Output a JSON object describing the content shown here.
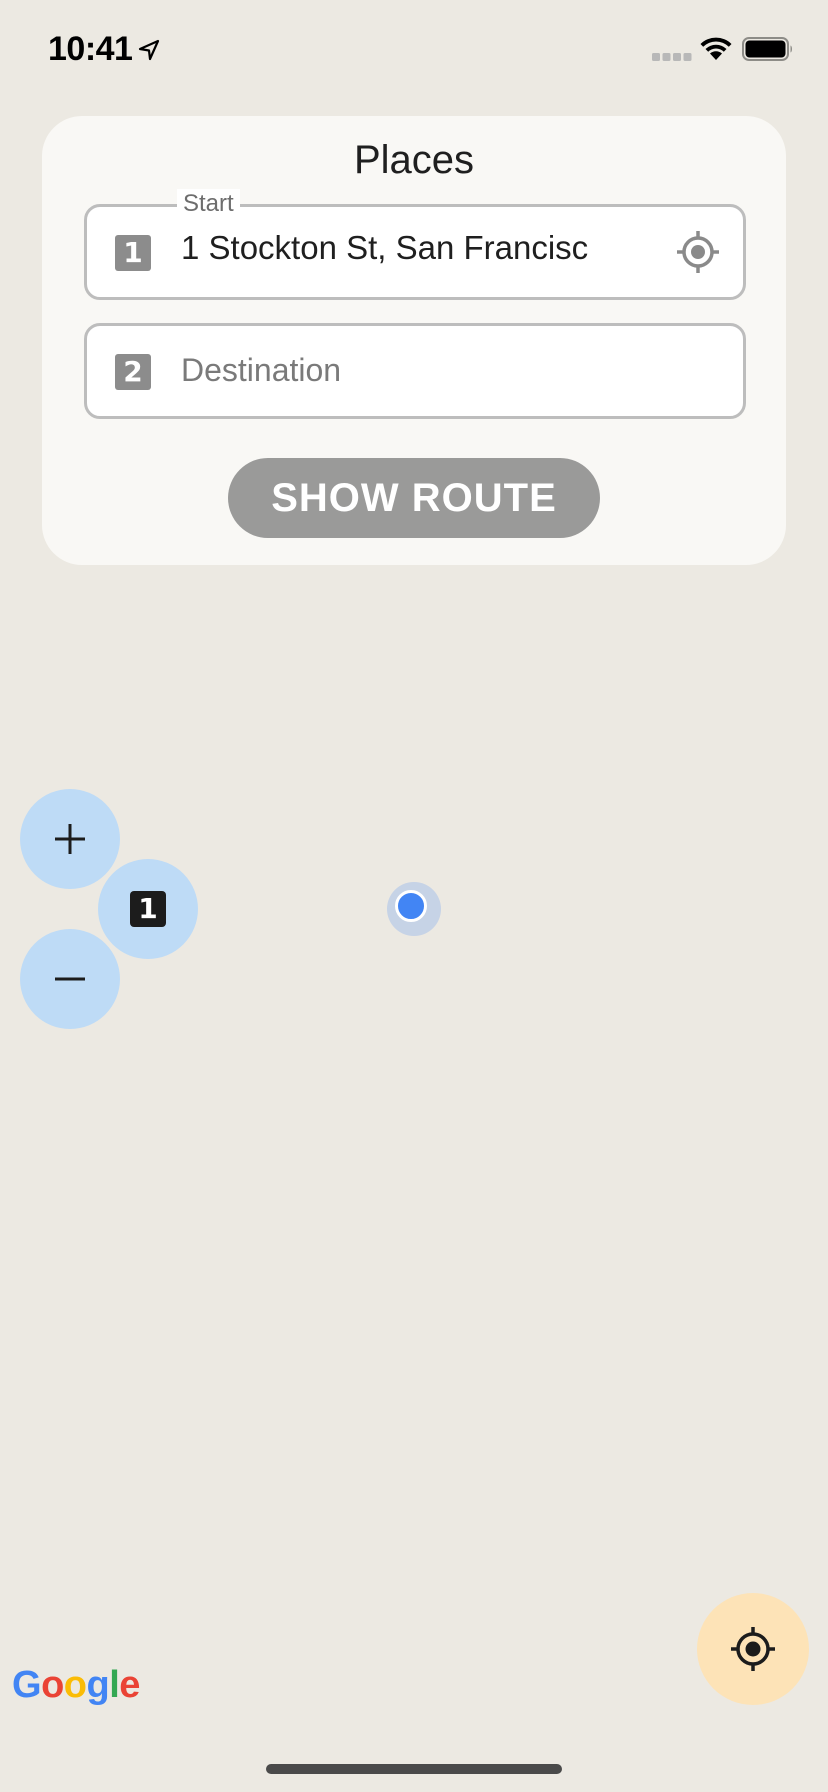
{
  "status_bar": {
    "time": "10:41"
  },
  "places_card": {
    "title": "Places",
    "start": {
      "legend": "Start",
      "badge": "1",
      "value": "1 Stockton St, San Francisc"
    },
    "destination": {
      "badge": "2",
      "placeholder": "Destination"
    },
    "show_route_label": "SHOW ROUTE"
  },
  "map": {
    "zoom_in_icon": "plus-icon",
    "zoom_out_icon": "minus-icon",
    "marker_badge": "1",
    "user_location_icon": "user-location-dot",
    "my_location_icon": "crosshair-icon",
    "logo": {
      "letters": [
        "G",
        "o",
        "o",
        "g",
        "l",
        "e"
      ],
      "colors": [
        "#4285f4",
        "#ea4335",
        "#fbbc05",
        "#4285f4",
        "#34a853",
        "#ea4335"
      ]
    }
  },
  "colors": {
    "map_background": "#ece9e2",
    "card_background": "#f9f8f5",
    "zoom_button": "#bedbf6",
    "fab": "#fde3b7",
    "route_button": "#9a9a99",
    "user_location": "#4285f4"
  }
}
